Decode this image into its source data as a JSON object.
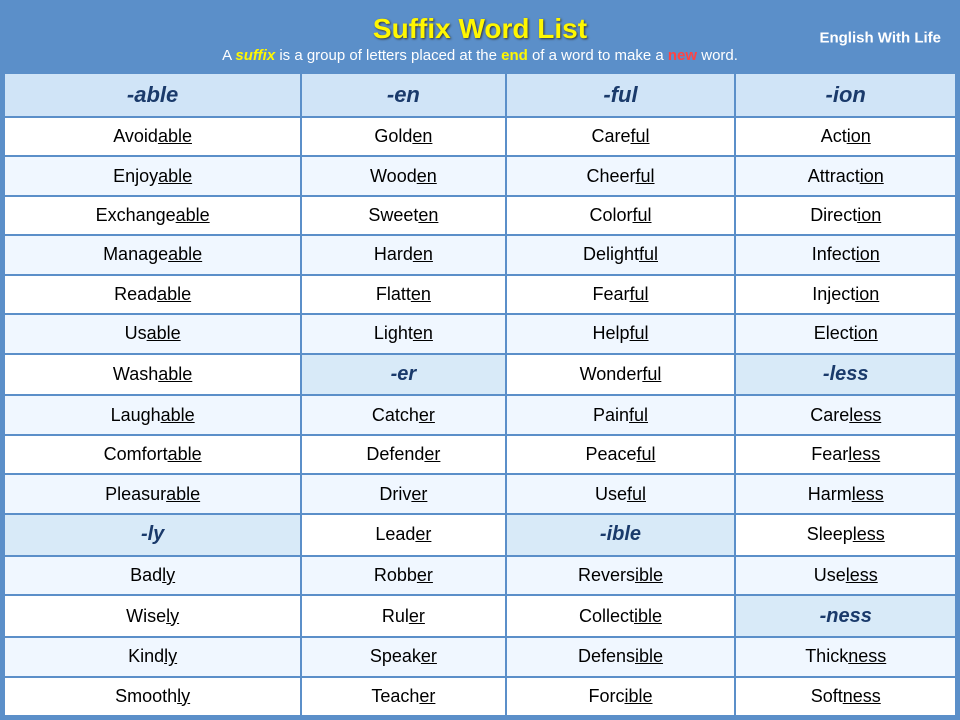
{
  "header": {
    "title": "Suffix Word List",
    "subtitle_prefix": "A ",
    "subtitle_suffix_word": "suffix",
    "subtitle_mid": " is a group of letters placed at the ",
    "subtitle_end": "end",
    "subtitle_mid2": " of a word to make a ",
    "subtitle_new": "new",
    "subtitle_end2": " word.",
    "branding": "English With Life"
  },
  "columns": [
    "-able",
    "-en",
    "-ful",
    "-ion"
  ],
  "rows": [
    [
      "Avoidable",
      "Golden",
      "Careful",
      "Action"
    ],
    [
      "Enjoyable",
      "Wooden",
      "Cheerful",
      "Attraction"
    ],
    [
      "Exchangeable",
      "Sweeten",
      "Colorful",
      "Direction"
    ],
    [
      "Manageable",
      "Harden",
      "Delightful",
      "Infection"
    ],
    [
      "Readable",
      "Flatten",
      "Fearful",
      "Injection"
    ],
    [
      "Usable",
      "Lighten",
      "Helpful",
      "Election"
    ],
    [
      "Washable",
      "-er",
      "Wonderful",
      "-less"
    ],
    [
      "Laughable",
      "Catcher",
      "Painful",
      "Careless"
    ],
    [
      "Comfortable",
      "Defender",
      "Peaceful",
      "Fearless"
    ],
    [
      "Pleasurable",
      "Driver",
      "Useful",
      "Harmless"
    ],
    [
      "-ly",
      "Leader",
      "-ible",
      "Sleepless"
    ],
    [
      "Badly",
      "Robber",
      "Reversible",
      "Useless"
    ],
    [
      "Wisely",
      "Ruler",
      "Collectible",
      "-ness"
    ],
    [
      "Kindly",
      "Speaker",
      "Defensible",
      "Thickness"
    ],
    [
      "Smoothly",
      "Teacher",
      "Forcible",
      "Softness"
    ]
  ],
  "suffix_rows": [
    6,
    10,
    12
  ],
  "suffixes_map": {
    "6": [
      null,
      "-er",
      null,
      "-less"
    ],
    "10": [
      "-ly",
      null,
      "-ible",
      null
    ],
    "12": [
      null,
      null,
      null,
      "-ness"
    ]
  }
}
